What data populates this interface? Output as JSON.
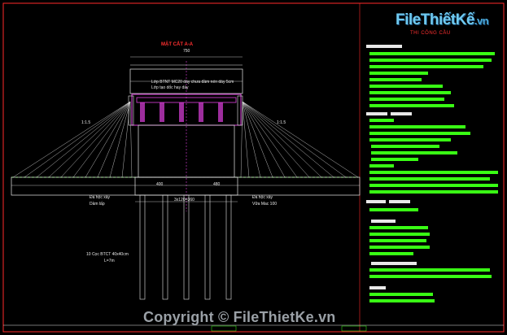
{
  "brand": {
    "logo_main": "FileThiết",
    "logo_mid": "Kế",
    "logo_dom": ".vn",
    "subtitle": "THI CÔNG CẦU"
  },
  "watermark": {
    "symbol": "©",
    "text": "Copyright © FileThietKe.vn"
  },
  "drawing": {
    "title": "MẶT CẮT A-A",
    "top_width": "750",
    "deck_note_1": "Lớp BTNT MC20 dày chưa đầm nén dày 5cm",
    "deck_note_2": "Lớp tạo dốc hay dày",
    "slope_left": "1:1.5",
    "slope_right": "1:1.5",
    "left_note": "Đá hộc xây",
    "left_note_2": "Dầm lấp",
    "right_note": "Đá hộc xây",
    "right_note_2": "Vữa Mac 100",
    "pile_note": "10 Cọc BTCT 40x40cm",
    "pile_len": "L=7m",
    "dim_400": "400",
    "dim_480": "480",
    "dim_center": "3x120=360"
  },
  "colors": {
    "line": "#e8e8e8",
    "green": "#39ff14",
    "magenta": "#e040e0",
    "red": "#ff2a2a",
    "cyan": "#3fd0ff"
  }
}
